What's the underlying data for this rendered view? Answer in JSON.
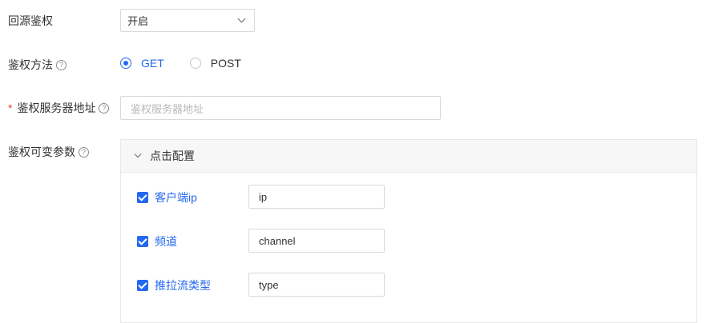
{
  "back_auth": {
    "label": "回源鉴权",
    "value": "开启"
  },
  "auth_method": {
    "label": "鉴权方法",
    "options": [
      "GET",
      "POST"
    ],
    "selected": "GET"
  },
  "auth_server": {
    "label": "鉴权服务器地址",
    "placeholder": "鉴权服务器地址",
    "required": "*"
  },
  "auth_params": {
    "label": "鉴权可变参数",
    "panel_title": "点击配置",
    "params": [
      {
        "label": "客户端ip",
        "value": "ip",
        "checked": true
      },
      {
        "label": "频道",
        "value": "channel",
        "checked": true
      },
      {
        "label": "推拉流类型",
        "value": "type",
        "checked": true
      }
    ]
  },
  "help_glyph": "?",
  "colors": {
    "accent": "#2468f2",
    "required": "#e8452c",
    "border": "#d9d9d9"
  }
}
